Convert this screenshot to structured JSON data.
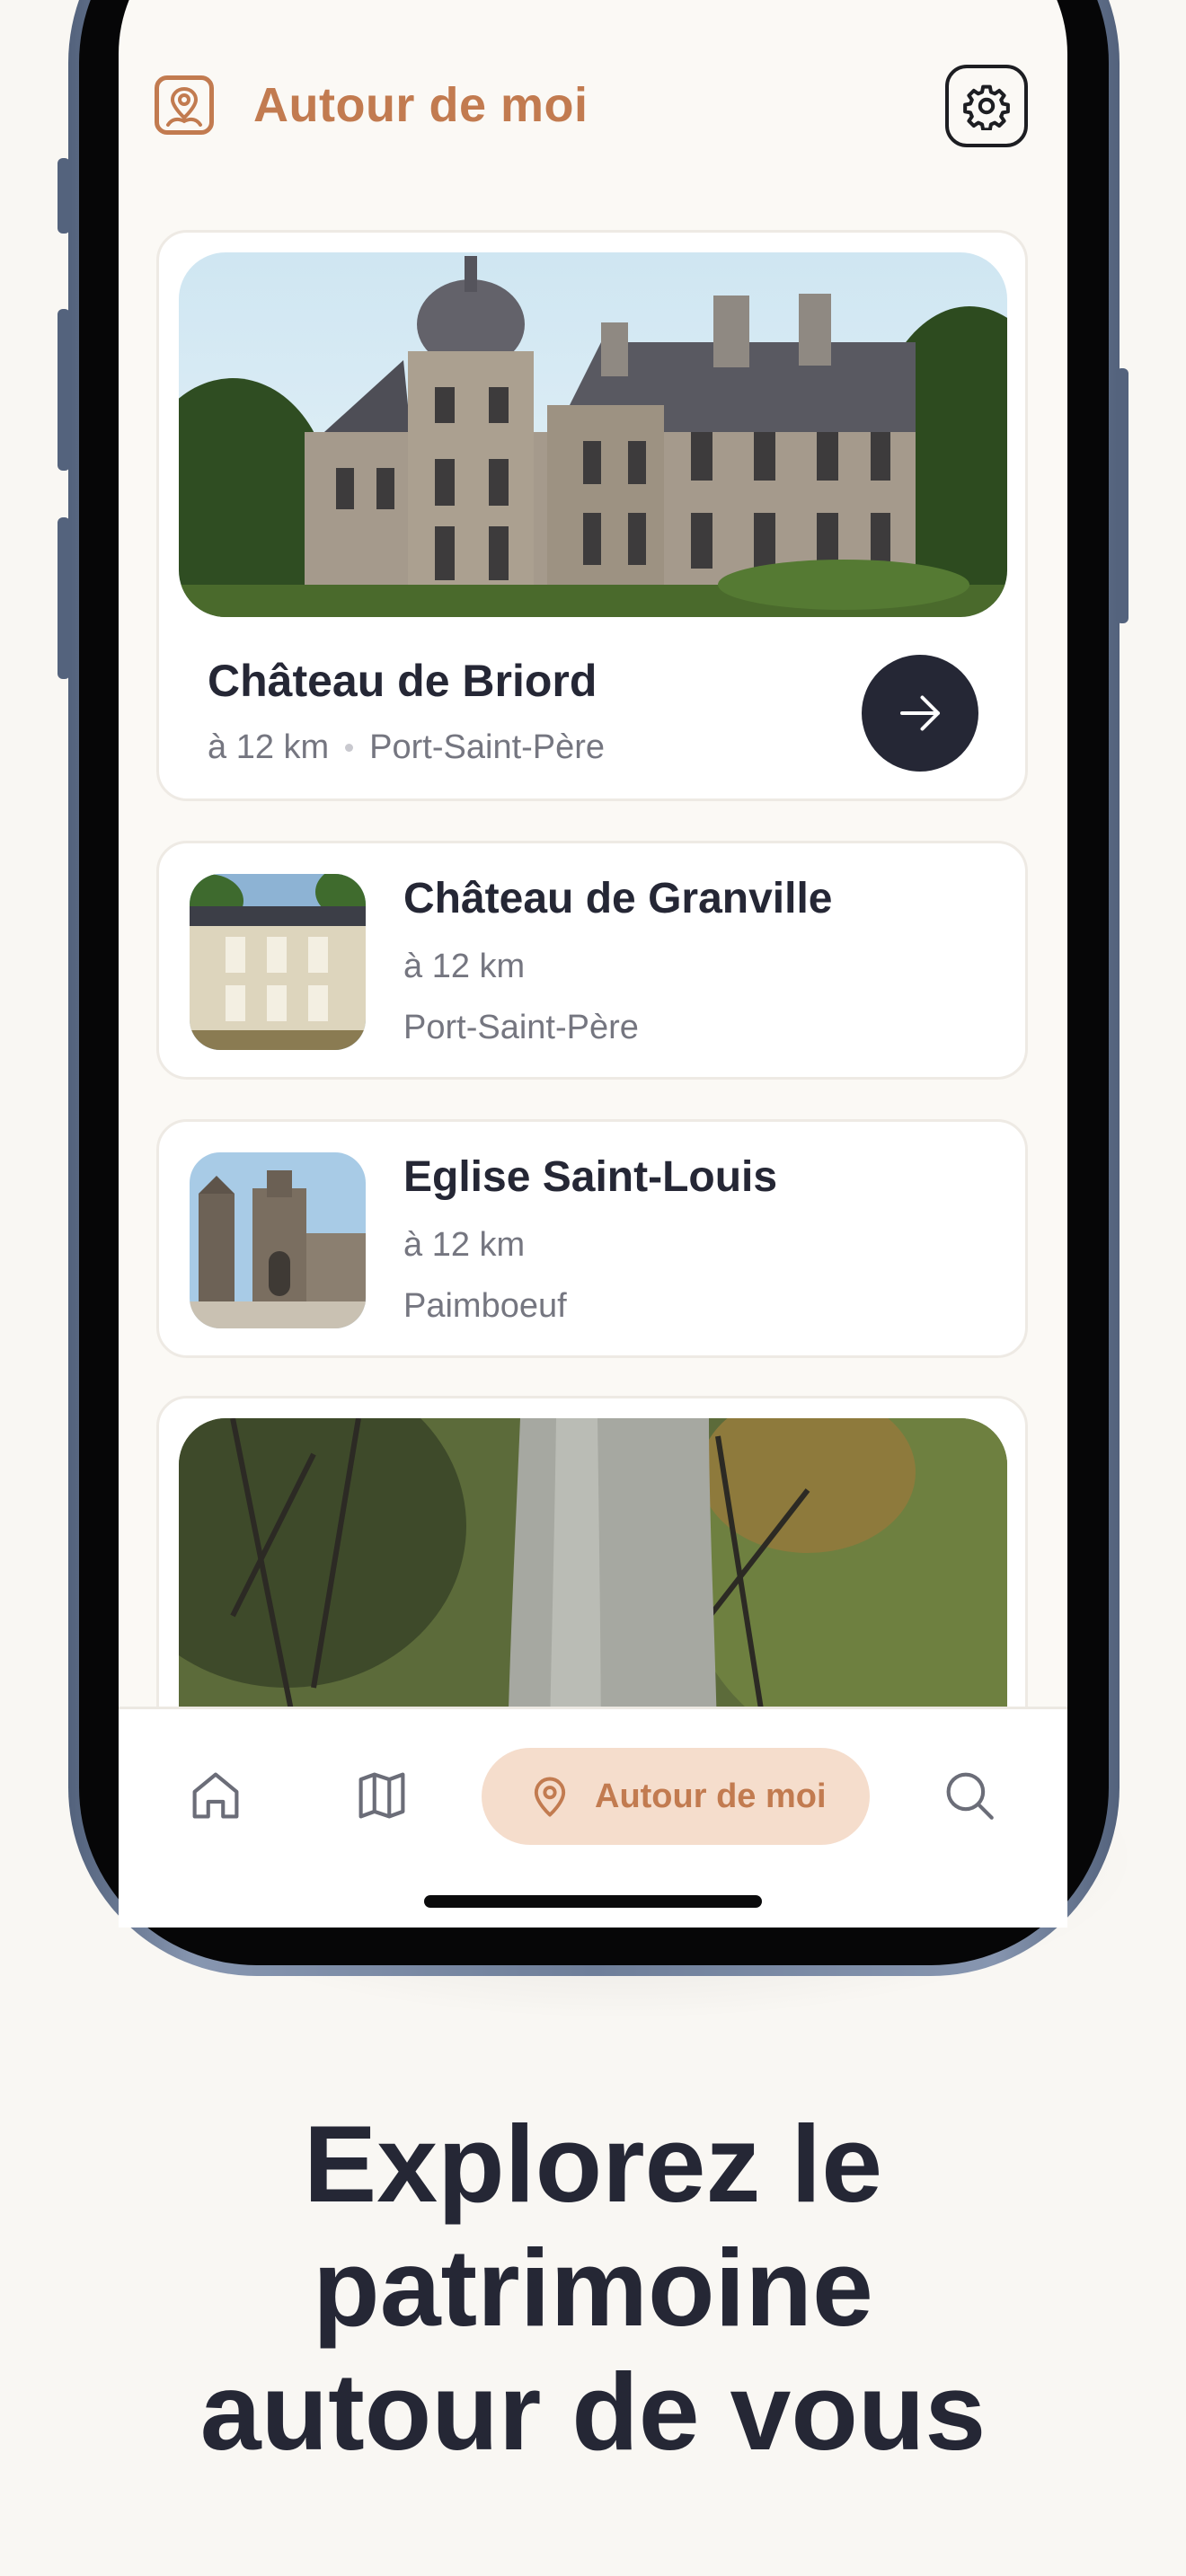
{
  "header": {
    "title": "Autour de moi",
    "icon": "location-person-icon",
    "settings_icon": "gear-icon"
  },
  "featured": {
    "title": "Château de Briord",
    "distance": "à 12 km",
    "place": "Port-Saint-Père",
    "action_icon": "arrow-right-icon"
  },
  "places": [
    {
      "title": "Château de Granville",
      "distance": "à 12 km",
      "place": "Port-Saint-Père"
    },
    {
      "title": "Eglise Saint-Louis",
      "distance": "à 12 km",
      "place": "Paimboeuf"
    }
  ],
  "tabbar": {
    "active_label": "Autour de moi",
    "icons": [
      "home-icon",
      "map-icon",
      "location-pin-icon",
      "search-icon"
    ]
  },
  "tagline": {
    "line1": "Explorez le",
    "line2": "patrimoine",
    "line3": "autour de vous"
  },
  "colors": {
    "accent": "#c27b50",
    "accent_soft": "#f5ddcc",
    "dark": "#252735",
    "muted": "#757680",
    "background": "#f9f7f3"
  }
}
